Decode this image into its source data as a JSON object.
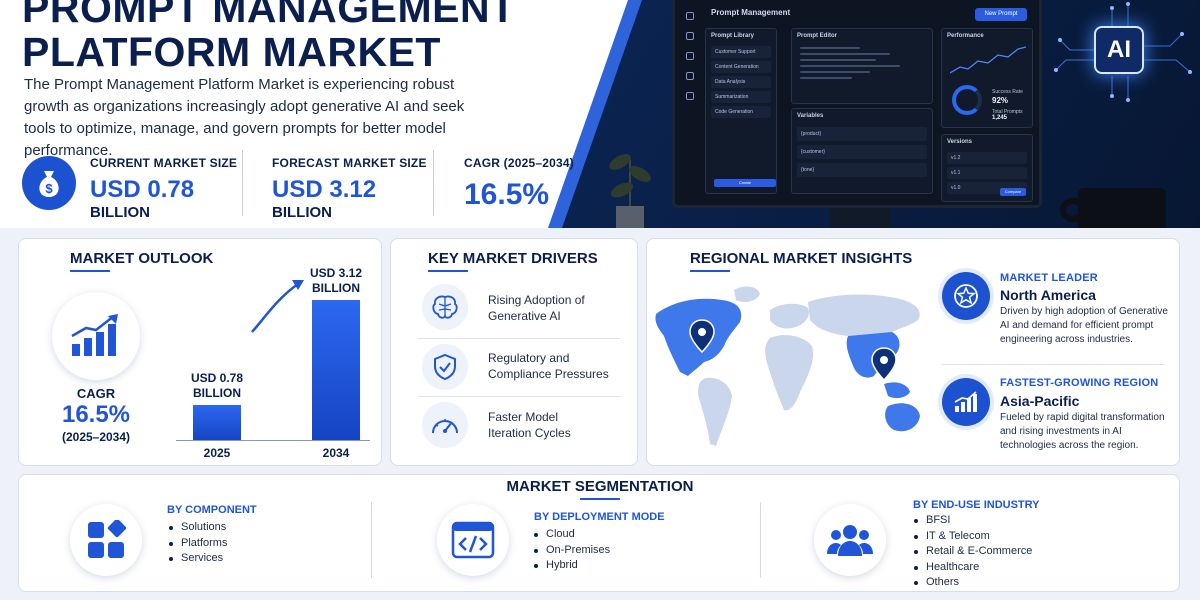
{
  "hero": {
    "title_line1": "PROMPT MANAGEMENT",
    "title_line2": "PLATFORM MARKET",
    "intro": "The Prompt Management Platform Market is experiencing robust growth as organizations increasingly adopt generative AI and seek tools to optimize, manage, and govern prompts for better model performance."
  },
  "stats": {
    "current": {
      "label": "CURRENT MARKET SIZE",
      "value": "USD 0.78",
      "unit": "BILLION"
    },
    "forecast": {
      "label": "FORECAST MARKET SIZE",
      "value": "USD 3.12",
      "unit": "BILLION"
    },
    "cagr": {
      "label": "CAGR (2025–2034)",
      "value": "16.5%"
    }
  },
  "dashboard": {
    "title": "Prompt Management",
    "new_button": "New Prompt",
    "library": {
      "title": "Prompt Library",
      "items": [
        "Customer Support",
        "Content Generation",
        "Data Analysis",
        "Summarization",
        "Code Generation"
      ],
      "button": "Create"
    },
    "editor": {
      "title": "Prompt Editor"
    },
    "variables": {
      "title": "Variables",
      "items": [
        "{product}",
        "{customer}",
        "{tone}"
      ]
    },
    "performance": {
      "title": "Performance",
      "success_label": "Success Rate",
      "success_value": "92%",
      "total_label": "Total Prompts",
      "total_value": "1,245"
    },
    "versions": {
      "title": "Versions",
      "items": [
        "v1.2",
        "v1.1",
        "v1.0"
      ],
      "compare": "Compare"
    },
    "ai_badge": "AI"
  },
  "outlook": {
    "title": "MARKET OUTLOOK",
    "cagr_label": "CAGR",
    "cagr_value": "16.5%",
    "cagr_years": "(2025–2034)",
    "chart_data": {
      "type": "bar",
      "categories": [
        "2025",
        "2034"
      ],
      "values": [
        0.78,
        3.12
      ],
      "labels": [
        [
          "USD 0.78",
          "BILLION"
        ],
        [
          "USD 3.12",
          "BILLION"
        ]
      ]
    }
  },
  "drivers": {
    "title": "KEY MARKET DRIVERS",
    "items": [
      {
        "line1": "Rising Adoption of",
        "line2": "Generative AI",
        "icon": "brain-icon"
      },
      {
        "line1": "Regulatory and",
        "line2": "Compliance Pressures",
        "icon": "shield-check-icon"
      },
      {
        "line1": "Faster Model",
        "line2": "Iteration Cycles",
        "icon": "speedometer-icon"
      }
    ]
  },
  "regional": {
    "title": "REGIONAL MARKET INSIGHTS",
    "leader": {
      "kicker": "MARKET LEADER",
      "name": "North America",
      "desc": "Driven by high adoption of Generative AI and demand for efficient prompt engineering across industries."
    },
    "fastest": {
      "kicker": "FASTEST-GROWING REGION",
      "name": "Asia-Pacific",
      "desc": "Fueled by rapid digital transformation and rising investments in AI technologies across the region."
    }
  },
  "segmentation": {
    "title": "MARKET SEGMENTATION",
    "component": {
      "head": "BY COMPONENT",
      "items": [
        "Solutions",
        "Platforms",
        "Services"
      ]
    },
    "deployment": {
      "head": "BY DEPLOYMENT MODE",
      "items": [
        "Cloud",
        "On-Premises",
        "Hybrid"
      ]
    },
    "industry": {
      "head": "BY END-USE INDUSTRY",
      "items": [
        "BFSI",
        "IT & Telecom",
        "Retail & E-Commerce",
        "Healthcare",
        "Others"
      ]
    }
  },
  "colors": {
    "brand": "#1f55d6",
    "navy": "#0a1f4d",
    "dark_bg": "#0b2452"
  }
}
